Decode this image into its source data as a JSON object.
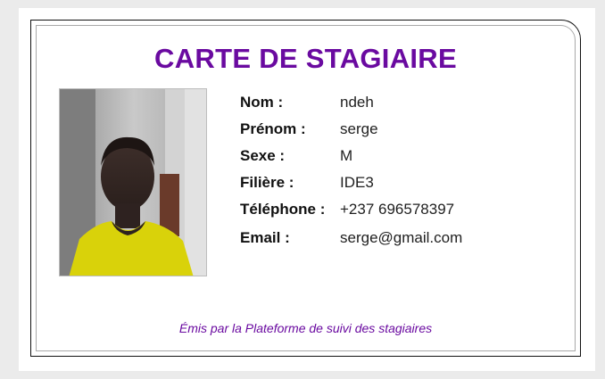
{
  "card": {
    "title": "CARTE DE STAGIAIRE",
    "footer": "Émis par la Plateforme de suivi des stagiaires",
    "accent_color": "#6a0aa0",
    "photo_icon": "trainee-photo"
  },
  "fields": [
    {
      "label": "Nom :",
      "value": "ndeh"
    },
    {
      "label": "Prénom :",
      "value": "serge"
    },
    {
      "label": "Sexe :",
      "value": "M"
    },
    {
      "label": "Filière :",
      "value": "IDE3"
    },
    {
      "label": "Téléphone :",
      "value": "+237 696578397"
    },
    {
      "label": "Email :",
      "value": "serge@gmail.com"
    }
  ]
}
